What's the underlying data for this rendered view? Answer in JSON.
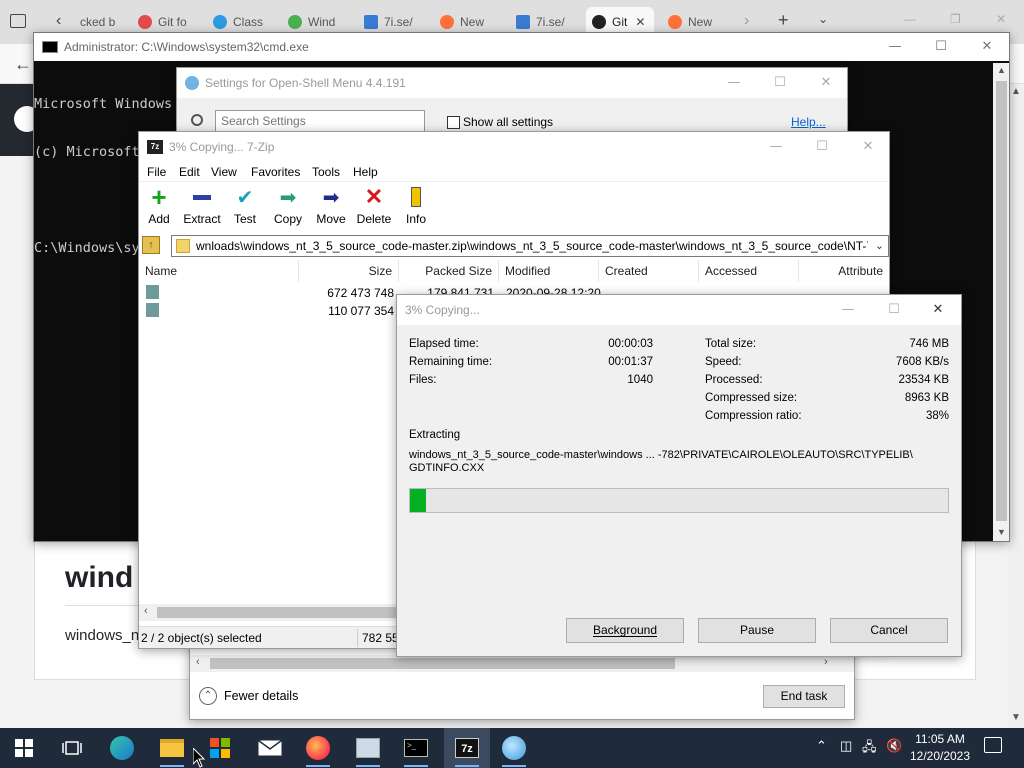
{
  "browser": {
    "tabs": [
      {
        "label": "cked b",
        "color": "#e0a030"
      },
      {
        "label": "Git fo",
        "color": "#e24b4b"
      },
      {
        "label": "Class",
        "color": "#2d9be0"
      },
      {
        "label": "Wind",
        "color": "#4caf50"
      },
      {
        "label": "7i.se/",
        "color": "#3a7bd5"
      },
      {
        "label": "New",
        "color": "#ff7139"
      },
      {
        "label": "7i.se/",
        "color": "#3a7bd5"
      },
      {
        "label": "Git",
        "color": "#222222"
      },
      {
        "label": "New",
        "color": "#ff7139"
      }
    ],
    "page_heading_partial": "wind",
    "page_text_partial": "windows_n"
  },
  "cmd": {
    "title": "Administrator: C:\\Windows\\system32\\cmd.exe",
    "lines": [
      "Microsoft Windows",
      "(c) Microsoft Corp",
      "",
      "C:\\Windows\\system3"
    ]
  },
  "openshell": {
    "title": "Settings for Open-Shell Menu 4.4.191",
    "search_placeholder": "Search Settings",
    "show_all": "Show all settings",
    "help": "Help..."
  },
  "taskmgr": {
    "fewer_details": "Fewer details",
    "end_task": "End task"
  },
  "zip": {
    "title": "3% Copying... 7-Zip",
    "menu": [
      "File",
      "Edit",
      "View",
      "Favorites",
      "Tools",
      "Help"
    ],
    "tools": [
      "Add",
      "Extract",
      "Test",
      "Copy",
      "Move",
      "Delete",
      "Info"
    ],
    "path": "wnloads\\windows_nt_3_5_source_code-master.zip\\windows_nt_3_5_source_code-master\\windows_nt_3_5_source_code\\NT-782\\",
    "columns": [
      "Name",
      "Size",
      "Packed Size",
      "Modified",
      "Created",
      "Accessed",
      "Attribute"
    ],
    "rows": [
      {
        "size": "672 473 748",
        "packed": "179 841 731",
        "modified": "2020-09-28 12:20"
      },
      {
        "size": "110 077 354",
        "packed": "",
        "modified": ""
      }
    ],
    "status": "2 / 2 object(s) selected",
    "status_size": "782 55"
  },
  "copy": {
    "title": "3% Copying...",
    "left_labels": [
      "Elapsed time:",
      "Remaining time:",
      "Files:"
    ],
    "left_values": [
      "00:00:03",
      "00:01:37",
      "1040"
    ],
    "right_labels": [
      "Total size:",
      "Speed:",
      "Processed:",
      "Compressed size:",
      "Compression ratio:"
    ],
    "right_values": [
      "746 MB",
      "7608 KB/s",
      "23534 KB",
      "8963 KB",
      "38%"
    ],
    "operation": "Extracting",
    "file_line1": "windows_nt_3_5_source_code-master\\windows ... -782\\PRIVATE\\CAIROLE\\OLEAUTO\\SRC\\TYPELIB\\",
    "file_line2": "GDTINFO.CXX",
    "progress": 0.03,
    "progress_color": "#06b025",
    "buttons": {
      "background": "Background",
      "pause": "Pause",
      "cancel": "Cancel"
    }
  },
  "taskbar": {
    "time": "11:05 AM",
    "date": "12/20/2023"
  }
}
